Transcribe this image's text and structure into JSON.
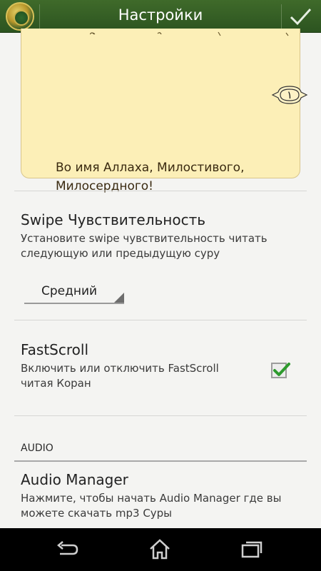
{
  "actionbar": {
    "title": "Настройки",
    "app_icon": "quran-app-icon",
    "done_icon": "checkmark-icon"
  },
  "preview": {
    "ayah_number": "١",
    "translation": "Во имя Аллаха, Милостивого, Милосердного!"
  },
  "swipe": {
    "title": "Swipe Чувствительность",
    "summary": "Установите swipe чувствительность читать следующую или предыдущую суру",
    "selected": "Средний"
  },
  "fastscroll": {
    "title": "FastScroll",
    "summary": "Включить или отключить FastScroll читая Коран",
    "checked": true
  },
  "audio_section": {
    "header": "AUDIO",
    "title": "Audio Manager",
    "summary": "Нажмите, чтобы начать Audio Manager где вы можете скачать mp3 Суры"
  },
  "navbar": {
    "back_icon": "back-icon",
    "home_icon": "home-icon",
    "recents_icon": "recent-apps-icon"
  },
  "colors": {
    "actionbar": "#2c5420",
    "card": "#fcefb7",
    "check": "#2e9a2e"
  }
}
